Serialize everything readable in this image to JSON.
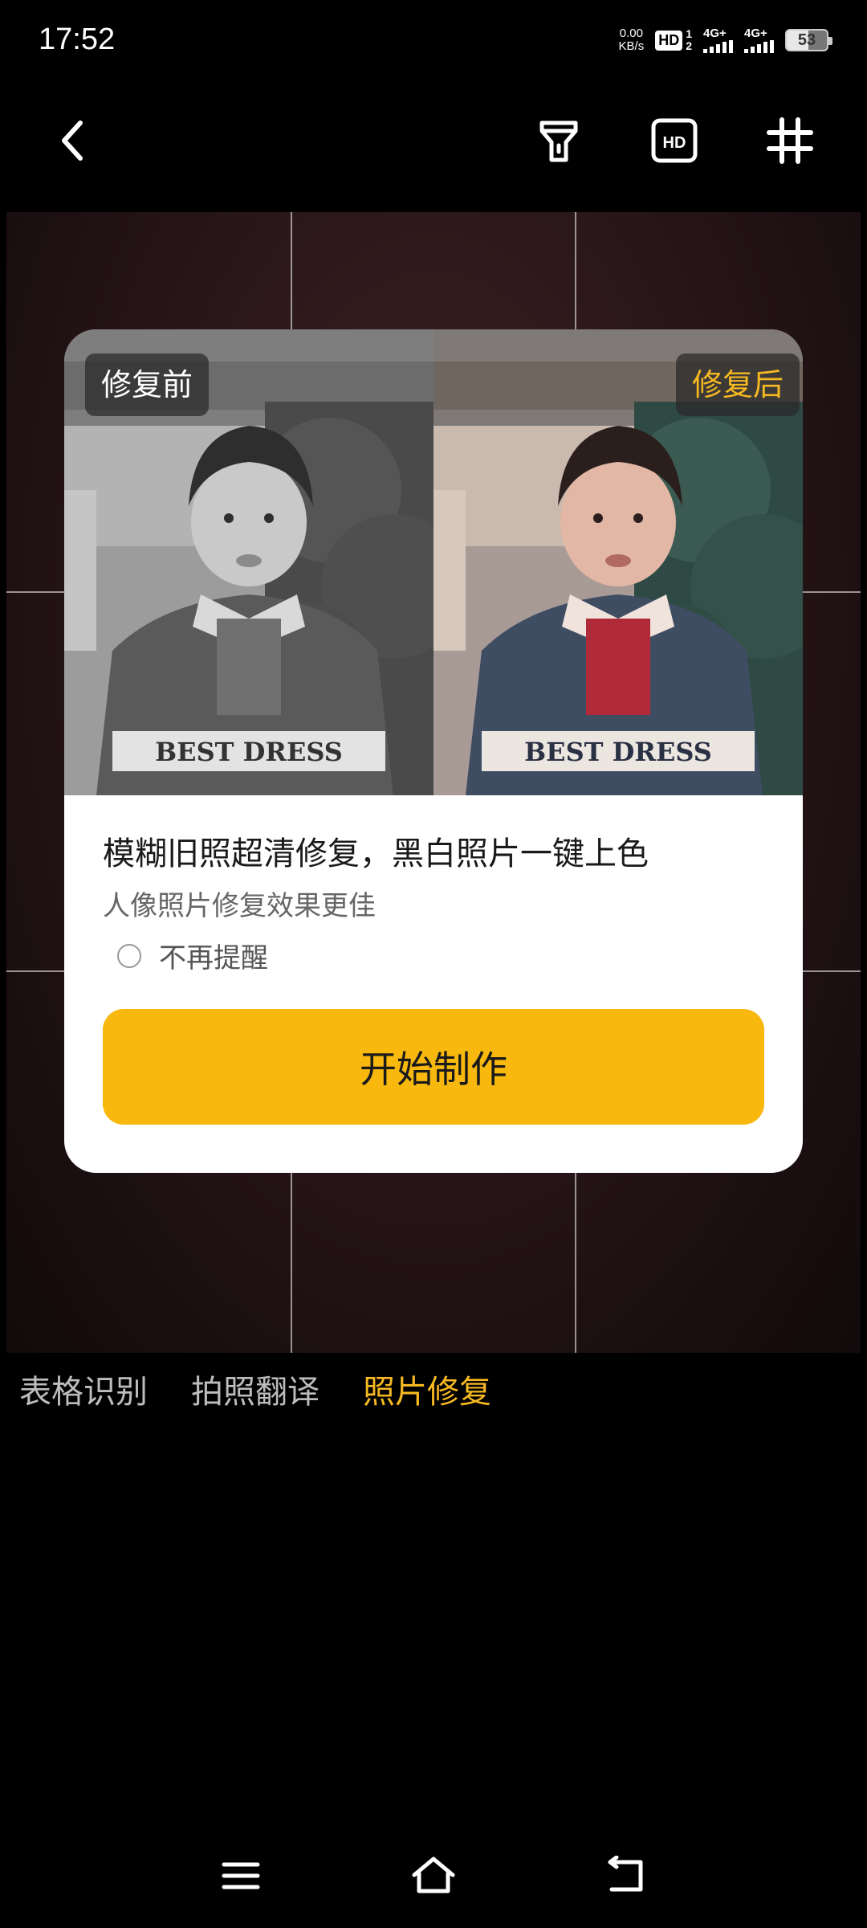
{
  "status_bar": {
    "time": "17:52",
    "net_speed_value": "0.00",
    "net_speed_unit": "KB/s",
    "hd_label": "HD",
    "hd_sim_top": "1",
    "hd_sim_bottom": "2",
    "signal_1_label": "4G+",
    "signal_2_label": "4G+",
    "battery_level": 53,
    "battery_text": "53"
  },
  "toolbar": {
    "back_icon": "chevron-left-icon",
    "flash_icon": "flashlight-icon",
    "hd_icon": "hd-icon",
    "grid_icon": "grid-icon"
  },
  "dialog": {
    "before_label": "修复前",
    "after_label": "修复后",
    "title": "模糊旧照超清修复，黑白照片一键上色",
    "subtitle": "人像照片修复效果更佳",
    "remind_label": "不再提醒",
    "remind_checked": false,
    "start_button": "开始制作",
    "photo_text_before": "BEST DRESS",
    "photo_text_after": "BEST DRESS"
  },
  "mode_tabs": [
    {
      "label": "表格识别",
      "active": false
    },
    {
      "label": "拍照翻译",
      "active": false
    },
    {
      "label": "照片修复",
      "active": true
    }
  ],
  "colors": {
    "accent": "#f8b80d",
    "accent_text": "#f6b921",
    "background": "#000000"
  },
  "nav_bar": {
    "menu_icon": "menu-icon",
    "home_icon": "home-icon",
    "back_icon": "back-icon"
  }
}
